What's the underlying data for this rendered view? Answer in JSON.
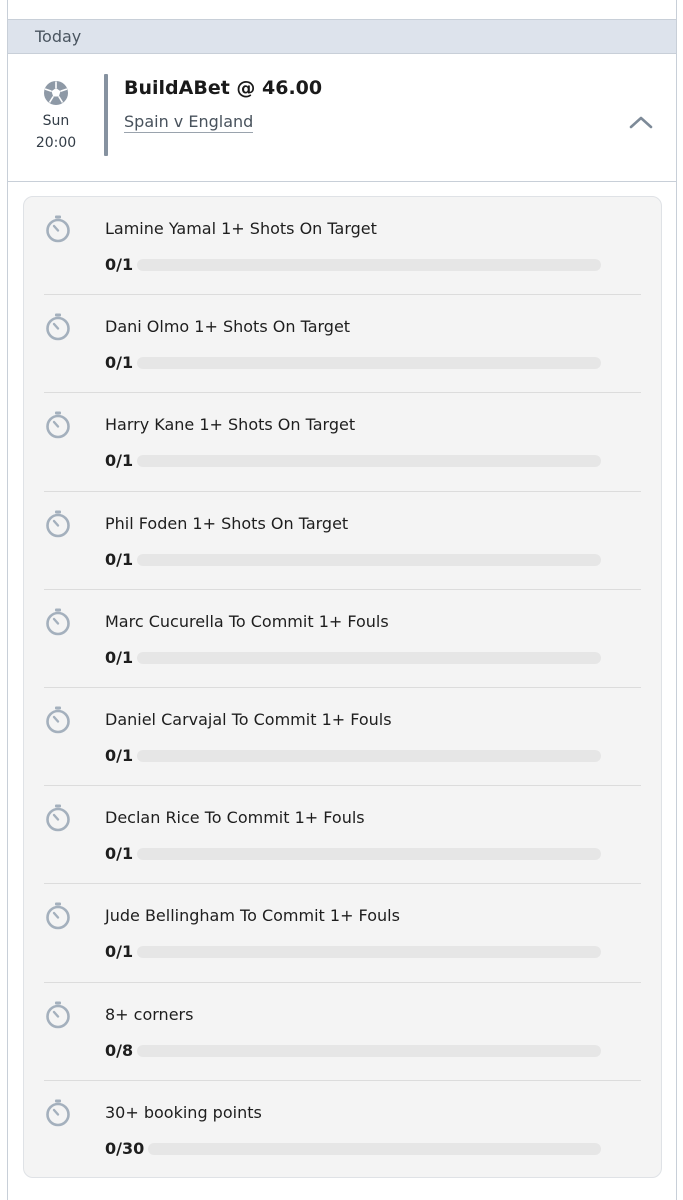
{
  "section": {
    "date_label": "Today"
  },
  "bet": {
    "day": "Sun",
    "time": "20:00",
    "title": "BuildABet @ 46.00",
    "match": "Spain v England",
    "sport_icon": "football-icon",
    "collapse_icon": "chevron-up-icon"
  },
  "colors": {
    "header_bg": "#dde3ec",
    "divider": "#8692a0",
    "card_bg": "#f4f4f4",
    "track": "#e6e6e6",
    "icon": "#a4b0bd"
  },
  "legs": [
    {
      "title": "Lamine Yamal 1+ Shots On Target",
      "progress_text": "0/1",
      "progress": 0
    },
    {
      "title": "Dani Olmo 1+ Shots On Target",
      "progress_text": "0/1",
      "progress": 0
    },
    {
      "title": "Harry Kane 1+ Shots On Target",
      "progress_text": "0/1",
      "progress": 0
    },
    {
      "title": "Phil Foden 1+ Shots On Target",
      "progress_text": "0/1",
      "progress": 0
    },
    {
      "title": "Marc Cucurella To Commit 1+ Fouls",
      "progress_text": "0/1",
      "progress": 0
    },
    {
      "title": "Daniel Carvajal To Commit 1+ Fouls",
      "progress_text": "0/1",
      "progress": 0
    },
    {
      "title": "Declan Rice To Commit 1+ Fouls",
      "progress_text": "0/1",
      "progress": 0
    },
    {
      "title": "Jude Bellingham To Commit 1+ Fouls",
      "progress_text": "0/1",
      "progress": 0
    },
    {
      "title": "8+ corners",
      "progress_text": "0/8",
      "progress": 0
    },
    {
      "title": "30+ booking points",
      "progress_text": "0/30",
      "progress": 0
    }
  ]
}
